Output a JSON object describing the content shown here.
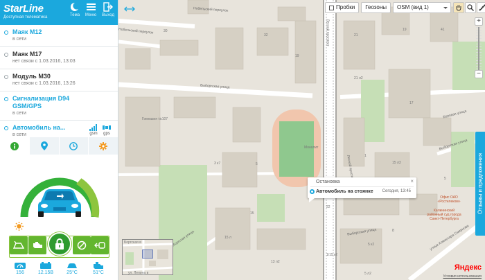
{
  "header": {
    "logo": "StarLine",
    "tagline": "Доступная телематика",
    "buttons": [
      {
        "label": "Тема",
        "icon": "theme-icon"
      },
      {
        "label": "Меню",
        "icon": "menu-icon"
      },
      {
        "label": "Выход",
        "icon": "exit-icon"
      }
    ]
  },
  "devices": [
    {
      "name": "Маяк M12",
      "status": "в сети",
      "online": true
    },
    {
      "name": "Маяк M17",
      "status": "нет связи с 1.03.2016, 13:03",
      "online": false
    },
    {
      "name": "Модуль M30",
      "status": "нет связи с 1.03.2016, 13:26",
      "online": false
    },
    {
      "name": "Сигнализация D94 GSM/GPS",
      "status": "в сети",
      "online": true
    },
    {
      "name": "Автомобиль на...",
      "status": "в сети",
      "online": true,
      "gsm": "gsm",
      "gps": "gps"
    }
  ],
  "tabs": [
    {
      "icon": "info-icon"
    },
    {
      "icon": "location-pin-icon"
    },
    {
      "icon": "clock-icon"
    },
    {
      "icon": "settings-gear-icon"
    }
  ],
  "stats": [
    {
      "value": "156",
      "icon": "tachometer-icon"
    },
    {
      "value": "12.15В",
      "icon": "battery-icon"
    },
    {
      "value": "25°C",
      "icon": "interior-temp-icon"
    },
    {
      "value": "51°C",
      "icon": "engine-temp-icon"
    }
  ],
  "map": {
    "toolbar": {
      "traffic": "Пробки",
      "geozones": "Геозоны",
      "layer": "OSM (вид 1)"
    },
    "feedback": "Отзывы и предложения",
    "popup": {
      "title": "Остановка",
      "close": "×",
      "name": "Автомобиль на стоянке",
      "time": "Сегодня, 13:45"
    },
    "labels": {
      "street1": "Нобельский переулок",
      "street2": "Нобельский переулок",
      "street3": "Выборгская улица",
      "street4": "Лесной проспект",
      "street5": "Лесной проспект",
      "street6": "Выборгская улица",
      "street7": "Выборгская улица",
      "street8": "Выборгская улица",
      "street9": "улица Комиссара Смирнова",
      "street10": "Боровая улица",
      "school": "Гимназия №107",
      "stadium": "Монолит",
      "office": "Офис ОАО «Ростелеком»",
      "court": "Калининский районный суд города Санкт-Петербурга",
      "mini1": "Боргская в",
      "mini2": "ул. Ленина в",
      "h1": "30",
      "h2": "32",
      "h3": "19",
      "h4": "3 к7",
      "h5": "5",
      "h6": "15",
      "h7": "15 л",
      "h8": "13 л2",
      "h9": "21",
      "h10": "19",
      "h11": "41",
      "h12": "21 л2",
      "h13": "17",
      "h14": "15 л3",
      "h15": "1",
      "h16": "15 к3",
      "h17": "22",
      "h18": "5",
      "h19": "1/15 к2",
      "h20": "5 к2",
      "h21": "8",
      "h22": "5 л2"
    },
    "attribution": "Условия использования",
    "provider": "Яндекс"
  }
}
